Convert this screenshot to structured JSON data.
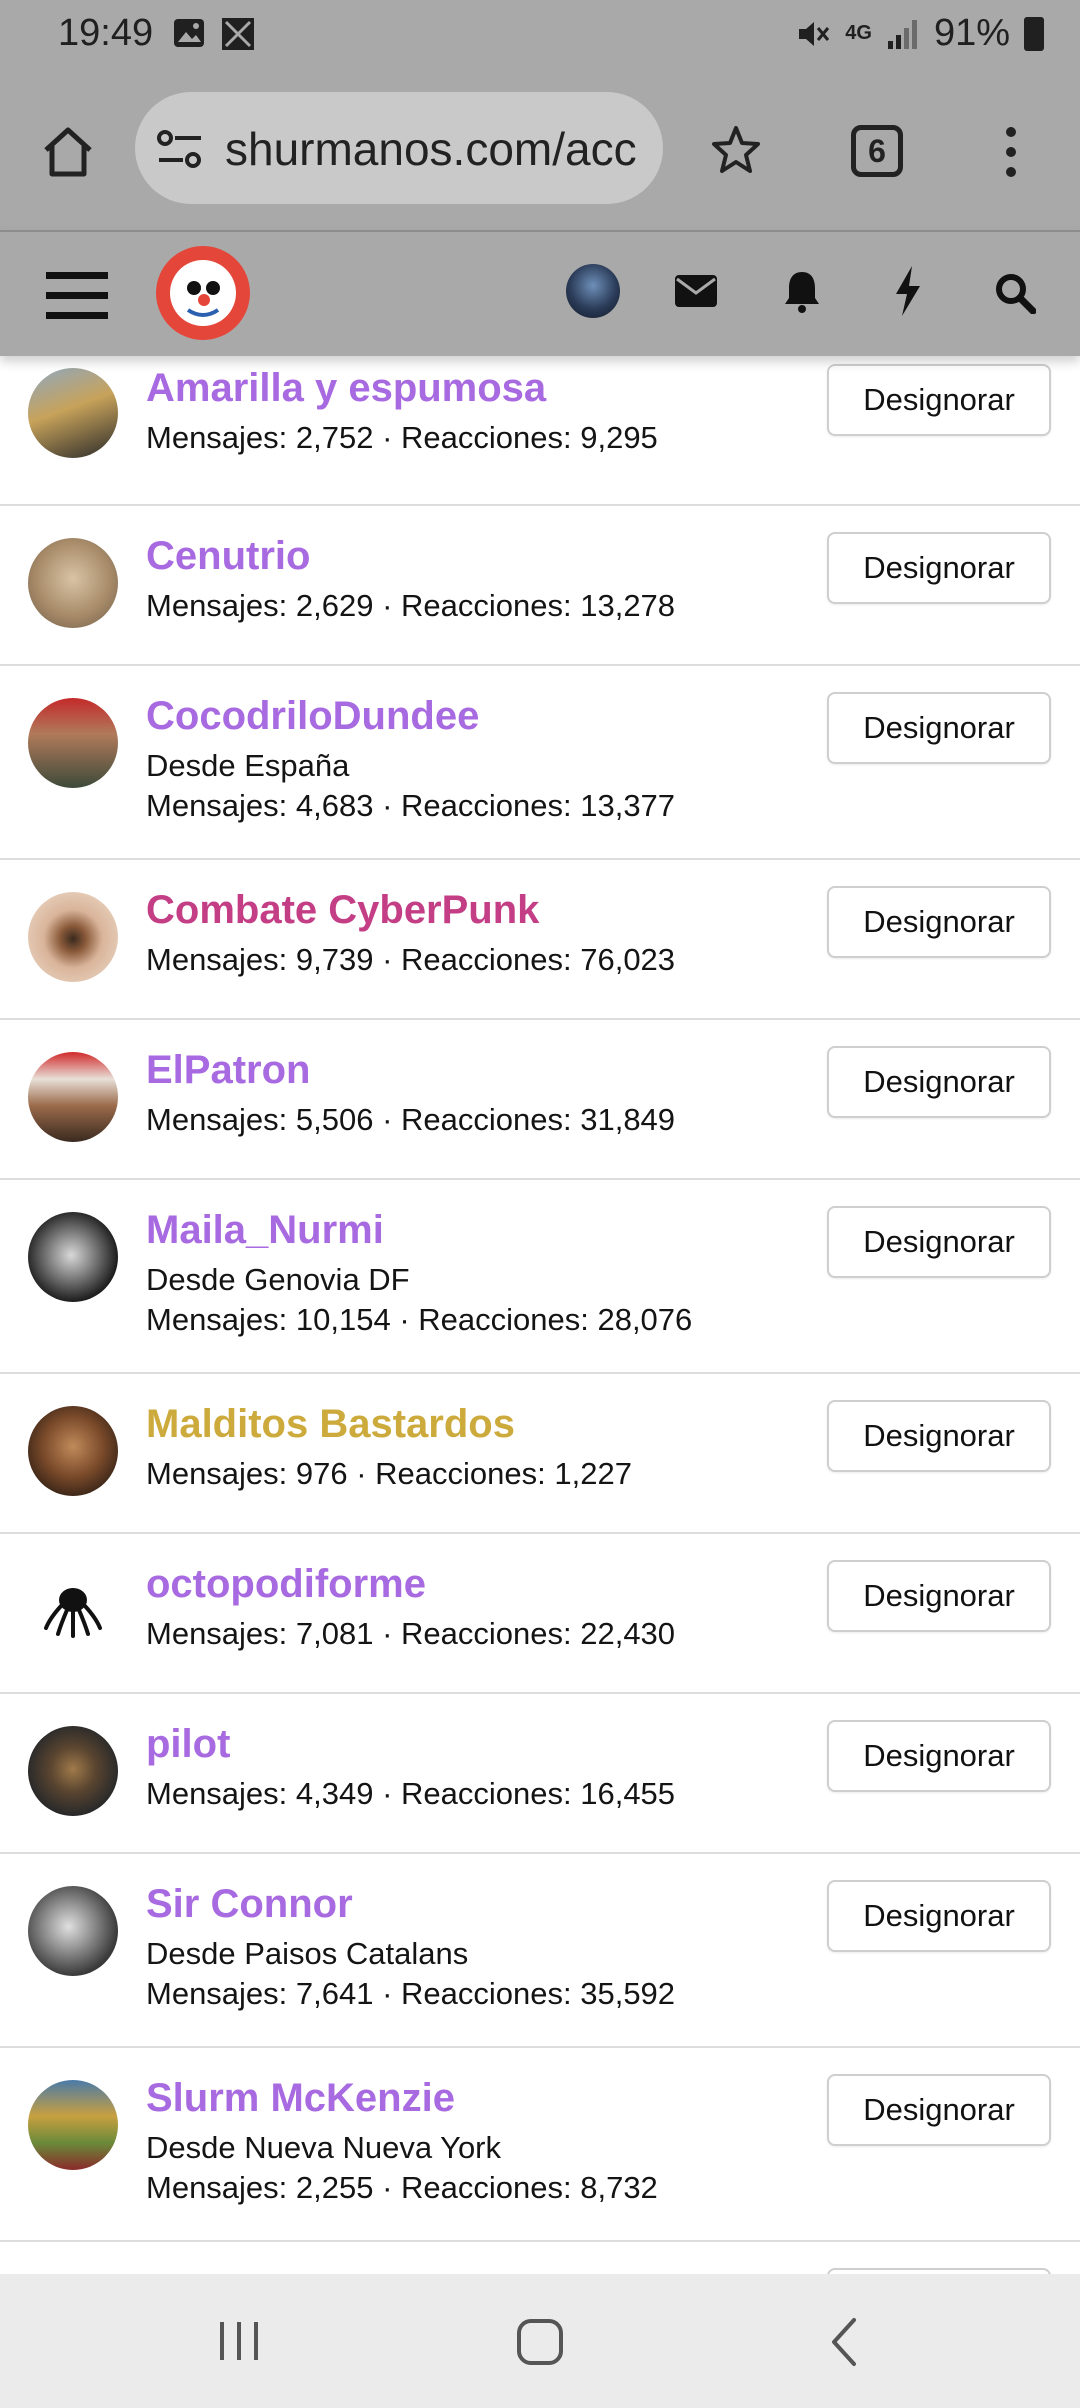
{
  "status": {
    "time": "19:49",
    "battery": "91%",
    "network": "4G"
  },
  "browser": {
    "url": "shurmanos.com/acc",
    "tab_count": "6"
  },
  "users": [
    {
      "name": "Amarilla y espumosa",
      "color": "#a86ae0",
      "location": "",
      "stats": "Mensajes: 2,752 · Reacciones: 9,295",
      "button": "Designorar"
    },
    {
      "name": "Cenutrio",
      "color": "#a86ae0",
      "location": "",
      "stats": "Mensajes: 2,629 · Reacciones: 13,278",
      "button": "Designorar"
    },
    {
      "name": "CocodriloDundee",
      "color": "#a86ae0",
      "location": "Desde España",
      "stats": "Mensajes: 4,683 · Reacciones: 13,377",
      "button": "Designorar"
    },
    {
      "name": "Combate CyberPunk",
      "color": "#c43e86",
      "location": "",
      "stats": "Mensajes: 9,739 · Reacciones: 76,023",
      "button": "Designorar"
    },
    {
      "name": "ElPatron",
      "color": "#a86ae0",
      "location": "",
      "stats": "Mensajes: 5,506 · Reacciones: 31,849",
      "button": "Designorar"
    },
    {
      "name": "Maila_Nurmi",
      "color": "#a86ae0",
      "location": "Desde Genovia DF",
      "stats": "Mensajes: 10,154 · Reacciones: 28,076",
      "button": "Designorar"
    },
    {
      "name": "Malditos Bastardos",
      "color": "#cdaa3c",
      "location": "",
      "stats": "Mensajes: 976 · Reacciones: 1,227",
      "button": "Designorar"
    },
    {
      "name": "octopodiforme",
      "color": "#a86ae0",
      "location": "",
      "stats": "Mensajes: 7,081 · Reacciones: 22,430",
      "button": "Designorar"
    },
    {
      "name": "pilot",
      "color": "#a86ae0",
      "location": "",
      "stats": "Mensajes: 4,349 · Reacciones: 16,455",
      "button": "Designorar"
    },
    {
      "name": "Sir Connor",
      "color": "#a86ae0",
      "location": "Desde Paisos Catalans",
      "stats": "Mensajes: 7,641 · Reacciones: 35,592",
      "button": "Designorar"
    },
    {
      "name": "Slurm McKenzie",
      "color": "#a86ae0",
      "location": "Desde Nueva Nueva York",
      "stats": "Mensajes: 2,255 · Reacciones: 8,732",
      "button": "Designorar"
    }
  ]
}
